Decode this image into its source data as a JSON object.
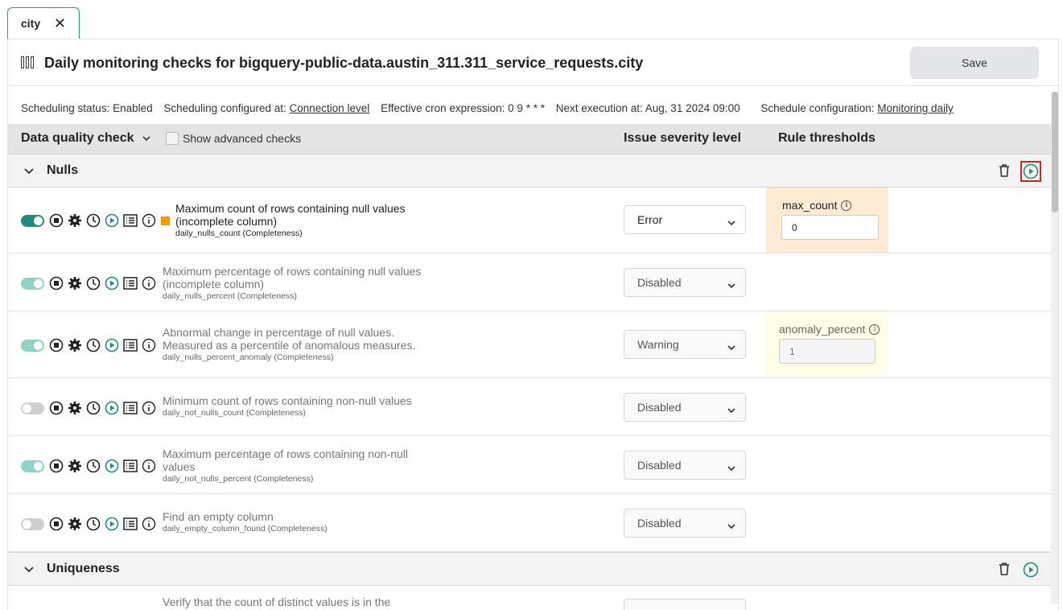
{
  "tab": {
    "label": "city",
    "close": "✕"
  },
  "header": {
    "title": "Daily monitoring checks for bigquery-public-data.austin_311.311_service_requests.city",
    "save_label": "Save"
  },
  "schedule": {
    "status": "Scheduling status: Enabled",
    "configured_prefix": "Scheduling configured at: ",
    "configured_link": "Connection level",
    "cron": "Effective cron expression: 0 9 * * *",
    "next": "Next execution at: Aug, 31 2024 09:00",
    "config_prefix": "Schedule configuration: ",
    "config_link": "Monitoring daily"
  },
  "columns": {
    "check": "Data quality check",
    "advanced": "Show advanced checks",
    "severity": "Issue severity level",
    "thresholds": "Rule thresholds"
  },
  "groups": [
    {
      "name": "Nulls"
    },
    {
      "name": "Uniqueness"
    }
  ],
  "rows": [
    {
      "title1": "Maximum count of rows containing null values",
      "title2": "(incomplete column)",
      "code": "daily_nulls_count",
      "category": "(Completeness)",
      "severity": "Error",
      "enabled": "on",
      "threshold_label": "max_count",
      "threshold_value": "0"
    },
    {
      "title1": "Maximum percentage of rows containing null values",
      "title2": "(incomplete column)",
      "code": "daily_nulls_percent",
      "category": "(Completeness)",
      "severity": "Disabled",
      "enabled": "on-dim"
    },
    {
      "title1": "Abnormal change in percentage of null values.",
      "title2": "Measured as a percentile of anomalous measures.",
      "code": "daily_nulls_percent_anomaly",
      "category": "(Completeness)",
      "severity": "Warning",
      "enabled": "on-dim",
      "threshold_label": "anomaly_percent",
      "threshold_value": "1"
    },
    {
      "title1": "Minimum count of rows containing non-null values",
      "title2": "",
      "code": "daily_not_nulls_count",
      "category": "(Completeness)",
      "severity": "Disabled",
      "enabled": "off"
    },
    {
      "title1": "Maximum percentage of rows containing non-null",
      "title2": "values",
      "code": "daily_not_nulls_percent",
      "category": "(Completeness)",
      "severity": "Disabled",
      "enabled": "on-dim"
    },
    {
      "title1": "Find an empty column",
      "title2": "",
      "code": "daily_empty_column_found",
      "category": "(Completeness)",
      "severity": "Disabled",
      "enabled": "off"
    },
    {
      "title1": "Verify that the count of distinct values is in the",
      "title2": "",
      "code": "",
      "category": "",
      "severity": "",
      "enabled": "off"
    }
  ],
  "icons": [
    "toggle",
    "stop-icon",
    "gear-icon",
    "clock-icon",
    "play-icon",
    "list-icon",
    "info-icon"
  ],
  "colors": {
    "accent": "#1f8d7c",
    "error": "#f29a00",
    "highlight": "#d32020"
  }
}
